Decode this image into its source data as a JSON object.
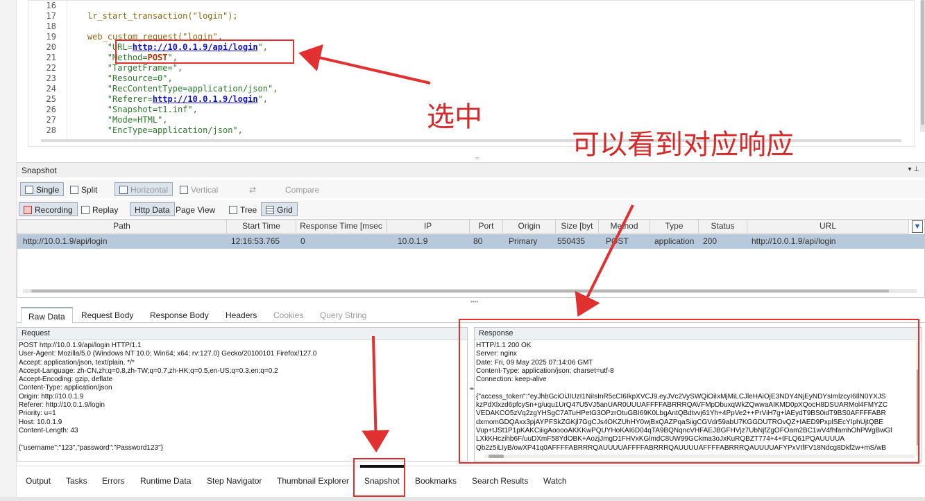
{
  "editor": {
    "lines": [
      {
        "n": "16",
        "t": ""
      },
      {
        "n": "17",
        "t": "    lr_start_transaction(\"login\");"
      },
      {
        "n": "18",
        "t": ""
      },
      {
        "n": "19",
        "t": "    web_custom_request(\"login\","
      },
      {
        "n": "20",
        "pre": "        \"URL=",
        "url": "http://10.0.1.9/api/login",
        "post": "\","
      },
      {
        "n": "21",
        "pre": "        \"Method=",
        "hl": "POST",
        "post": "\","
      },
      {
        "n": "22",
        "t": "        \"TargetFrame=\","
      },
      {
        "n": "23",
        "t": "        \"Resource=0\","
      },
      {
        "n": "24",
        "t": "        \"RecContentType=application/json\","
      },
      {
        "n": "25",
        "pre": "        \"Referer=",
        "url": "http://10.0.1.9/login",
        "post": "\","
      },
      {
        "n": "26",
        "t": "        \"Snapshot=t1.inf\","
      },
      {
        "n": "27",
        "t": "        \"Mode=HTML\","
      },
      {
        "n": "28",
        "t": "        \"EncType=application/json\","
      }
    ]
  },
  "snapshot": {
    "title": "Snapshot",
    "controls": "▾ ⊥",
    "toolbar1": {
      "single": "Single",
      "split": "Split",
      "horizontal": "Horizontal",
      "vertical": "Vertical",
      "compare": "Compare"
    },
    "toolbar2": {
      "recording": "Recording",
      "replay": "Replay",
      "http_data": "Http Data",
      "page_view": "Page View",
      "tree": "Tree",
      "grid": "Grid"
    }
  },
  "grid": {
    "headers": [
      "Path",
      "Start Time",
      "Response Time [msec",
      "IP",
      "Port",
      "Origin",
      "Size [byt",
      "Method",
      "Type",
      "Status",
      "URL"
    ],
    "rows": [
      [
        "http://10.0.1.9/api/login",
        "12:16:53.765",
        "0",
        "10.0.1.9",
        "80",
        "Primary",
        "550435",
        "POST",
        "application",
        "200",
        "http://10.0.1.9/api/login"
      ]
    ]
  },
  "detail_tabs": [
    "Raw Data",
    "Request Body",
    "Response Body",
    "Headers",
    "Cookies",
    "Query String"
  ],
  "request": {
    "title": "Request",
    "body": "POST http://10.0.1.9/api/login HTTP/1.1\nUser-Agent: Mozilla/5.0 (Windows NT 10.0; Win64; x64; rv:127.0) Gecko/20100101 Firefox/127.0\nAccept: application/json, text/plain, */*\nAccept-Language: zh-CN,zh;q=0.8,zh-TW;q=0.7,zh-HK;q=0.5,en-US;q=0.3,en;q=0.2\nAccept-Encoding: gzip, deflate\nContent-Type: application/json\nOrigin: http://10.0.1.9\nReferer: http://10.0.1.9/login\nPriority: u=1\nHost: 10.0.1.9\nContent-Length: 43\n\n{\"username\":\"123\",\"password\":\"Password123\"}"
  },
  "response": {
    "title": "Response",
    "body": "HTTP/1.1 200 OK\nServer: nginx\nDate: Fri, 09 May 2025 07:14:06 GMT\nContent-Type: application/json; charset=utf-8\nConnection: keep-alive\n\n{\"access_token\":\"eyJhbGciOiJIUzI1NiIsInR5cCI6IkpXVCJ9.eyJVc2VySWQiOiIxMjMiLCJleHAiOjE3NDY4NjEyNDYsImlzcyI6IlN0YXJS\nkzPdXlxzd6pfcySn+g/uqu1UrQ47U5VJ5anUAR0UUUAFFFFABRRRQAVFMpDbuxqWkZQwwaAIKMD0pXQocH8DSUARMol4FMYZC\nVEDAKCO5zVq2zgYHSgC7ATuHPetG3OPzrOtuGBI69K0LbgAntQBdtvvj61Yh+4PpVe2++PrViH7g+lAEydT9BS0idT9BS0AFFFFABR\ndxmomGDQAxx3pjAYPFSkZGKjl7GgCJs4OKZUhHY0wjBxQAZPqaSiigCGVdr59abU7KGGDUTROvQZ+IAED9PxplSEcYIphUjtQBE\nVup+tJSt1P1pKAKCiiigAooooAKKKwPQUYHoKAI6D04qTA9BQNqncVHFAEJBGFHVjz7UbNjfZgOFOam2BC1wV4fhfamhOhPWgBwGl\nLXkKHczihb6F/uuDXmF58YdOBK+AozjJmgD1FHVxKGlmdC8UW99GCkma3oJxKuRQBZT774+4+tFLQ61PQAUUUUA\nQb2z5iLIyB/owXP41q0AFFFFABRRRQAUUUUAFFFFABRRRQAUUUUAFFFFABRRRQAUUUUAFYPxVtfFV18Ndcg8Dkf2w+mS/wB"
  },
  "bottom_tabs": [
    "Output",
    "Tasks",
    "Errors",
    "Runtime Data",
    "Step Navigator",
    "Thumbnail Explorer",
    "Snapshot",
    "Bookmarks",
    "Search Results",
    "Watch"
  ],
  "annotations": {
    "select_label": "选中",
    "response_label": "可以看到对应响应",
    "color": "#e03030"
  }
}
